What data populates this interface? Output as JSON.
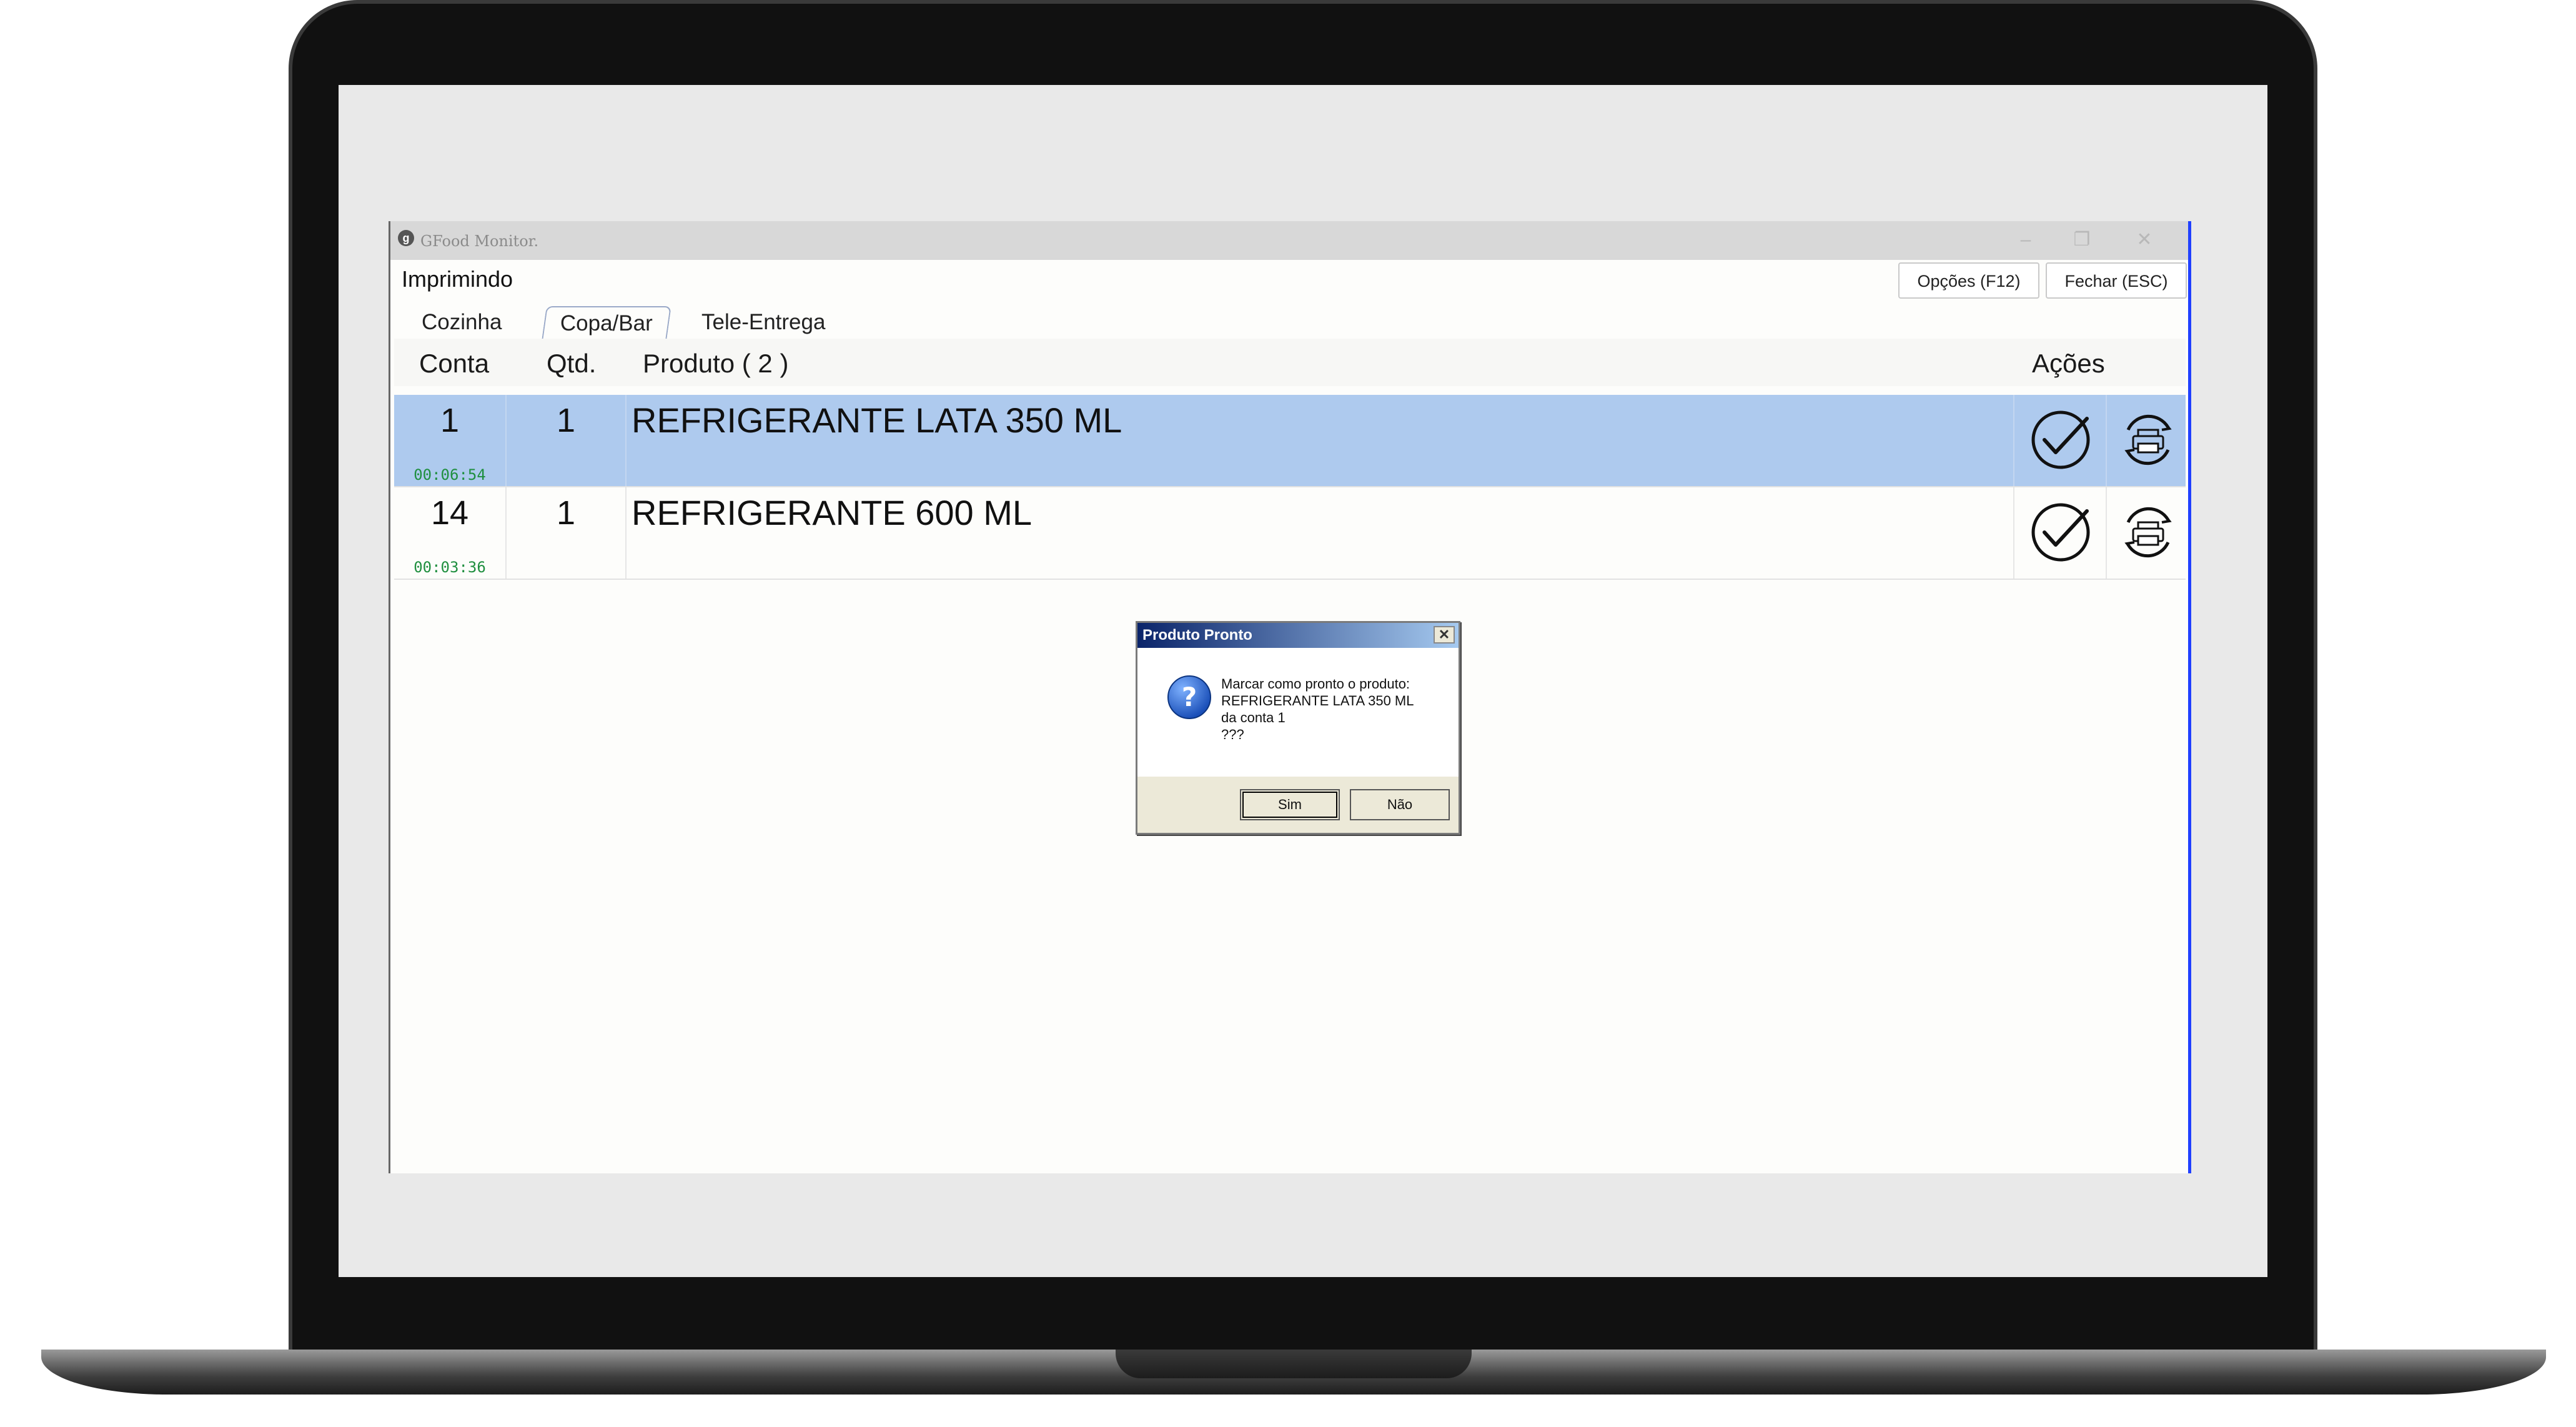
{
  "window": {
    "title": "GFood Monitor.",
    "app_icon": "gfood-logo-icon",
    "controls": [
      "–",
      "❐",
      "✕"
    ]
  },
  "status": "Imprimindo",
  "toolbar": {
    "options_label": "Opções (F12)",
    "close_label": "Fechar (ESC)"
  },
  "tabs": [
    {
      "label": "Cozinha",
      "active": false
    },
    {
      "label": "Copa/Bar",
      "active": true
    },
    {
      "label": "Tele-Entrega",
      "active": false
    }
  ],
  "table": {
    "headers": {
      "conta": "Conta",
      "qtd": "Qtd.",
      "produto": "Produto ( 2 )",
      "acoes": "Ações"
    },
    "rows": [
      {
        "conta": "1",
        "timer": "00:06:54",
        "qtd": "1",
        "produto": "REFRIGERANTE LATA 350 ML",
        "selected": true
      },
      {
        "conta": "14",
        "timer": "00:03:36",
        "qtd": "1",
        "produto": "REFRIGERANTE 600 ML",
        "selected": false
      }
    ]
  },
  "dialog": {
    "title": "Produto Pronto",
    "icon": "question-icon",
    "message": "Marcar como pronto o produto:\nREFRIGERANTE LATA 350 ML\nda conta 1\n???",
    "yes_label": "Sim",
    "no_label": "Não",
    "close_symbol": "✕"
  },
  "colors": {
    "selected_row": "#aecaee",
    "timer": "#1f8f3f",
    "dialog_title": "#0a246a",
    "window_border": "#2040ff"
  }
}
